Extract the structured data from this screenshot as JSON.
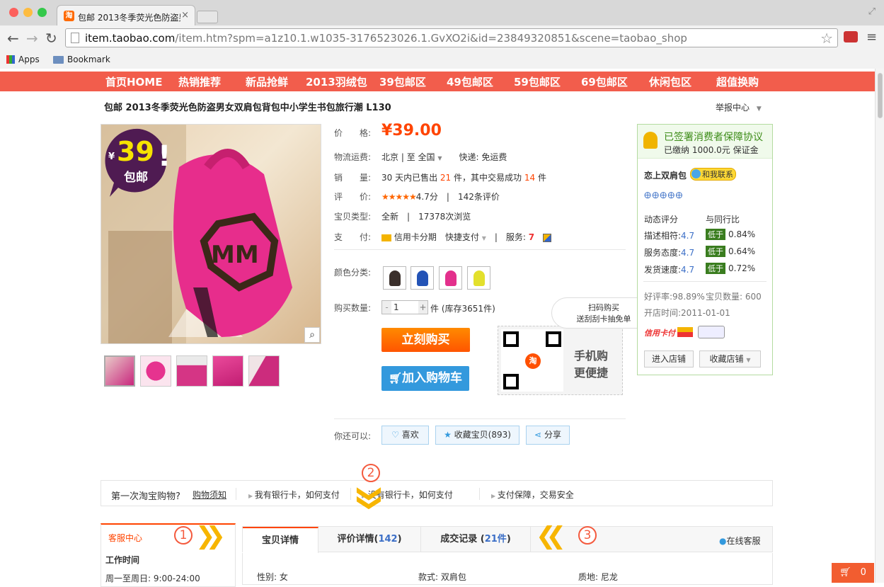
{
  "browser": {
    "tab_title": "包邮 2013冬季荧光色防盗男",
    "tab_favicon": "淘",
    "url_host": "item.taobao.com",
    "url_path": "/item.htm?spm=a1z10.1.w1035-3176523026.1.GvXO2i&id=23849320851&scene=taobao_shop",
    "bookmarks": [
      "Apps",
      "Bookmark"
    ]
  },
  "nav": [
    "首页HOME",
    "热销推荐",
    "新品抢鲜",
    "2013羽绒包",
    "39包邮区",
    "49包邮区",
    "59包邮区",
    "69包邮区",
    "休闲包区",
    "超值换购"
  ],
  "product": {
    "title": "包邮 2013冬季荧光色防盗男女双肩包背包中小学生书包旅行潮 L130",
    "report": "举报中心",
    "badge_price": "39",
    "badge_yen": "¥",
    "badge_text": "包邮",
    "price_label": "价　　格:",
    "price": "¥39.00",
    "shipping_label": "物流运费:",
    "shipping_from": "北京",
    "shipping_to_label": "至",
    "shipping_to": "全国",
    "shipping_express": "快递: 免运费",
    "sales_label": "销　　量:",
    "sales_prefix": "30 天内已售出",
    "sales_count": "21",
    "sales_mid": "件，其中交易成功",
    "sales_success": "14",
    "sales_suffix": "件",
    "rating_label": "评　　价:",
    "rating_stars": "★★★★★",
    "rating_score": "4.7分",
    "rating_count": "142条评价",
    "type_label": "宝贝类型:",
    "type_value": "全新",
    "views": "17378次浏览",
    "pay_label": "支　　付:",
    "pay_credit": "信用卡分期",
    "pay_fast": "快捷支付",
    "service_label": "服务:",
    "color_label": "颜色分类:",
    "qty_label": "购买数量:",
    "qty_value": "1",
    "qty_unit": "件",
    "stock": "(库存3651件)",
    "buy_now": "立刻购买",
    "add_cart": "加入购物车",
    "qr_bubble_1": "扫码购买",
    "qr_bubble_2": "送刮刮卡抽免单",
    "qr_text_1": "手机购",
    "qr_text_2": "更便捷",
    "also_label": "你还可以:",
    "like": "喜欢",
    "collect": "收藏宝贝(893)",
    "share": "分享"
  },
  "store": {
    "guarantee": "已签署消费者保障协议",
    "deposit": "已缴纳 1000.0元 保证金",
    "name": "恋上双肩包",
    "contact": "和我联系",
    "dyn_label": "动态评分",
    "peer_label": "与同行比",
    "scores": [
      {
        "label": "描述相符:",
        "score": "4.7",
        "cmp": "低于",
        "pct": "0.84%"
      },
      {
        "label": "服务态度:",
        "score": "4.7",
        "cmp": "低于",
        "pct": "0.64%"
      },
      {
        "label": "发货速度:",
        "score": "4.7",
        "cmp": "低于",
        "pct": "0.72%"
      }
    ],
    "good_rate": "好评率:98.89%",
    "item_count": "宝贝数量: 600",
    "open_time": "开店时间:2011-01-01",
    "enter_shop": "进入店铺",
    "collect_shop": "收藏店铺"
  },
  "firsttime": {
    "title": "第一次淘宝购物?",
    "link": "购物须知",
    "items": [
      "我有银行卡，如何支付",
      "没有银行卡，如何支付",
      "支付保障，交易安全"
    ]
  },
  "service": {
    "title": "客服中心",
    "hours_title": "工作时间",
    "hours": "周一至周日: 9:00-24:00"
  },
  "tabs": {
    "detail": "宝贝详情",
    "reviews": "评价详情",
    "reviews_count": "142",
    "records": "成交记录",
    "records_count": "21件",
    "online": "在线客服"
  },
  "attrs": [
    "性别: 女",
    "款式: 双肩包",
    "质地: 尼龙"
  ],
  "annotations": [
    "1",
    "2",
    "3"
  ],
  "cart_count": "0",
  "colors": {
    "nav": "#f25d4c",
    "price": "#ff4400",
    "buy": "#ff6a00",
    "cart": "#3399dd"
  }
}
